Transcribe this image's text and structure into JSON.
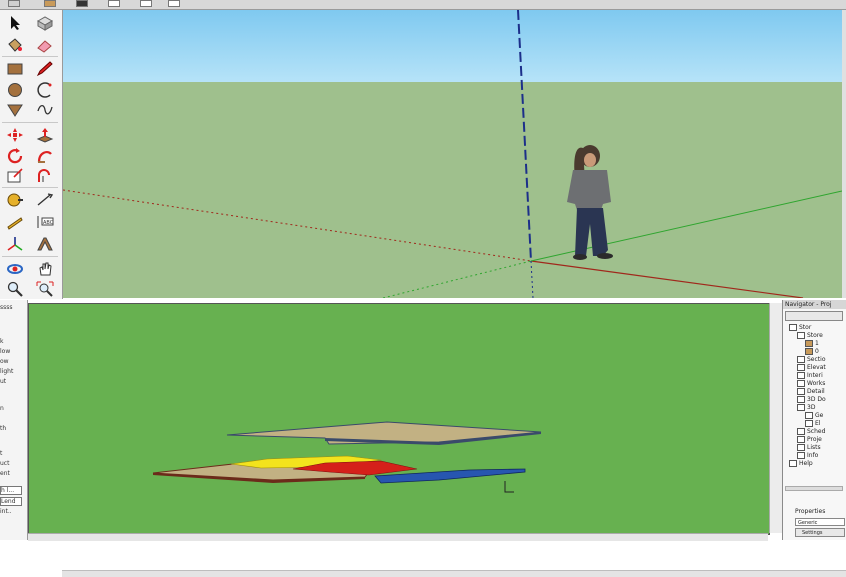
{
  "sketchup": {
    "toolbar_tools": [
      "select-icon",
      "eraser-icon",
      "paint-bucket-icon",
      "eraser2-icon",
      "rectangle-icon",
      "pencil-icon",
      "circle-icon",
      "arc-icon",
      "polygon-icon",
      "freehand-icon",
      "move-icon",
      "push-pull-icon",
      "rotate-icon",
      "follow-me-icon",
      "scale-icon",
      "offset-icon",
      "tape-measure-icon",
      "dimension-icon",
      "protractor-icon",
      "text-icon",
      "axes-icon",
      "3d-text-icon",
      "orbit-icon",
      "pan-icon",
      "zoom-icon",
      "zoom-extents-icon"
    ],
    "colors": {
      "sky": "#8fd3f4",
      "ground": "#9fc08d",
      "red_axis": "#a0281c",
      "green_axis": "#2fa52f",
      "blue_axis": "#1c2f8a"
    }
  },
  "archicad": {
    "left_panel_items": [
      "ssss",
      "k",
      "low",
      "ow",
      "light",
      "ut",
      "",
      "n",
      "th",
      "",
      "t",
      "uct",
      "ent"
    ],
    "left_panel_buttons": [
      "h l...",
      "Lend",
      "int.."
    ],
    "navigator": {
      "title": "Navigator - Proj",
      "tree": [
        "Stor",
        "Store",
        "1",
        "0",
        "Sectio",
        "Elevat",
        "Interi",
        "Works",
        "Detail",
        "3D Do",
        "3D",
        "Ge",
        "El",
        "Sched",
        "Proje",
        "Lists",
        "Info",
        "Help"
      ],
      "properties_label": "Properties",
      "field_label": "Generic",
      "button_label": "Settings"
    },
    "colors": {
      "bg": "#67b150",
      "slab": "#c2b183",
      "yellow": "#f3e31d",
      "red": "#d5201a",
      "blue": "#2756b0"
    }
  }
}
